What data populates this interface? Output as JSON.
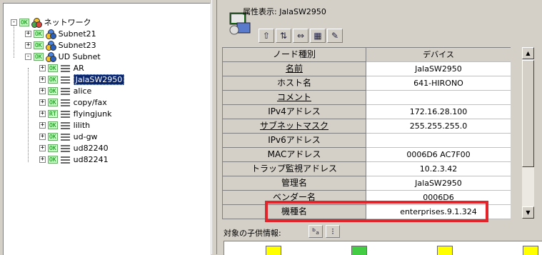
{
  "tree": {
    "root": {
      "label": "ネットワーク",
      "badge": "OK"
    },
    "items": [
      {
        "label": "Subnet21",
        "badge": "OK",
        "kind": "network",
        "toggle": "+"
      },
      {
        "label": "Subnet23",
        "badge": "OK",
        "kind": "network",
        "toggle": "+"
      },
      {
        "label": "UD Subnet",
        "badge": "OK",
        "kind": "network",
        "toggle": "-"
      },
      {
        "label": "AR",
        "badge": "OK",
        "kind": "device",
        "toggle": "+"
      },
      {
        "label": "JalaSW2950",
        "badge": "OK",
        "kind": "device",
        "toggle": "+",
        "selected": true
      },
      {
        "label": "alice",
        "badge": "OK",
        "kind": "device",
        "toggle": "+"
      },
      {
        "label": "copy/fax",
        "badge": "OK",
        "kind": "device",
        "toggle": "+"
      },
      {
        "label": "flyingjunk",
        "badge": "RT",
        "kind": "device",
        "toggle": "+"
      },
      {
        "label": "lilith",
        "badge": "OK",
        "kind": "device",
        "toggle": "+"
      },
      {
        "label": "ud-gw",
        "badge": "OK",
        "kind": "device",
        "toggle": "+"
      },
      {
        "label": "ud82240",
        "badge": "OK",
        "kind": "device",
        "toggle": "+"
      },
      {
        "label": "ud82241",
        "badge": "OK",
        "kind": "device",
        "toggle": "+"
      }
    ]
  },
  "panel": {
    "title": "属性表示: JalaSW2950"
  },
  "properties": {
    "header": {
      "key": "ノード種別",
      "value": "デバイス"
    },
    "rows": [
      {
        "key": "名前",
        "value": "JalaSW2950"
      },
      {
        "key": "ホスト名",
        "value": "641-HIRONO"
      },
      {
        "key": "コメント",
        "value": ""
      },
      {
        "key": "IPv4アドレス",
        "value": "172.16.28.100"
      },
      {
        "key": "サブネットマスク",
        "value": "255.255.255.0"
      },
      {
        "key": "IPv6アドレス",
        "value": ""
      },
      {
        "key": "MACアドレス",
        "value": "0006D6 AC7F00"
      },
      {
        "key": "トラップ監視アドレス",
        "value": "10.2.3.42"
      },
      {
        "key": "管理名",
        "value": "JalaSW2950"
      },
      {
        "key": "ベンダー名",
        "value": "0006D6"
      },
      {
        "key": "機種名",
        "value": "enterprises.9.1.324"
      }
    ]
  },
  "child_info": {
    "label": "対象の子供情報:"
  },
  "colors": {
    "highlight": "#e3242b",
    "selection": "#0a246a"
  }
}
